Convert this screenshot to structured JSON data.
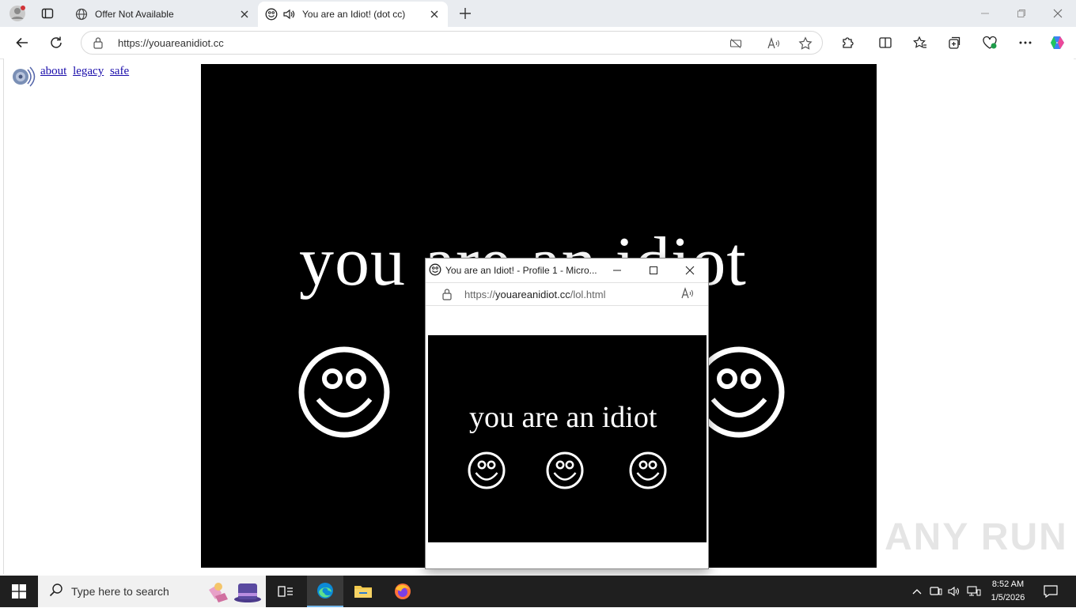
{
  "browser": {
    "tabs": [
      {
        "title": "Offer Not Available",
        "active": false,
        "icon": "globe-icon"
      },
      {
        "title": "You are an Idiot! (dot cc)",
        "active": true,
        "icon": "smiley-icon",
        "audio": true
      }
    ],
    "address": {
      "url": "https://youareanidiot.cc"
    }
  },
  "page": {
    "links": [
      "about",
      "legacy",
      "safe"
    ],
    "headline": "you are an idiot",
    "smiley_count": 3
  },
  "popup": {
    "title": "You are an Idiot! - Profile 1 - Micro...",
    "url_scheme": "https://",
    "url_host": "youareanidiot.cc",
    "url_path": "/lol.html",
    "headline": "you are an idiot",
    "smiley_count": 3
  },
  "watermark": "ANY RUN",
  "taskbar": {
    "search_placeholder": "Type here to search",
    "time": "8:52 AM",
    "date": "1/5/2026"
  },
  "colors": {
    "stage_bg": "#000000",
    "stage_text": "#ffffff",
    "link": "#1a0dab",
    "taskbar_bg": "#1f1f1f",
    "tabstrip_bg": "#e9ecf0"
  }
}
